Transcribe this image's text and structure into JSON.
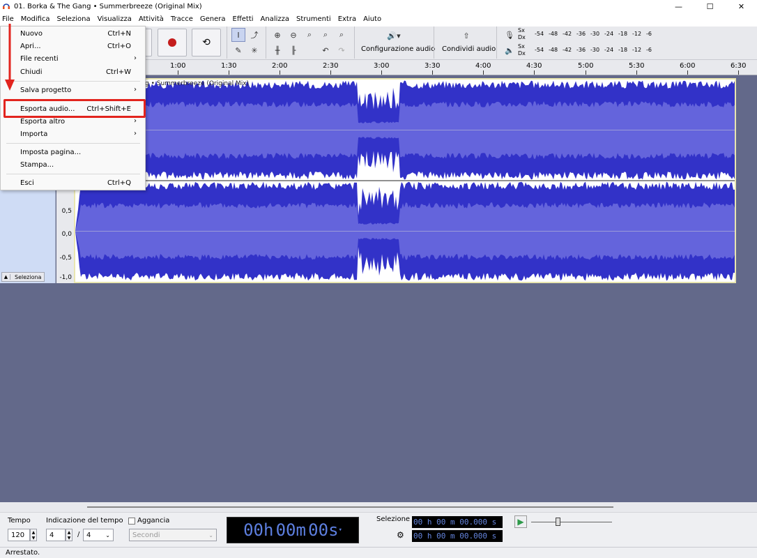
{
  "window": {
    "title": "01. Borka & The Gang • Summerbreeze (Original Mix)",
    "minimize": "—",
    "maximize": "☐",
    "close": "✕"
  },
  "menubar": [
    "File",
    "Modifica",
    "Seleziona",
    "Visualizza",
    "Attività",
    "Tracce",
    "Genera",
    "Effetti",
    "Analizza",
    "Strumenti",
    "Extra",
    "Aiuto"
  ],
  "file_menu": {
    "items": [
      {
        "label": "Nuovo",
        "shortcut": "Ctrl+N"
      },
      {
        "label": "Apri...",
        "shortcut": "Ctrl+O"
      },
      {
        "label": "File recenti",
        "submenu": true
      },
      {
        "label": "Chiudi",
        "shortcut": "Ctrl+W"
      },
      {
        "label": "Salva progetto",
        "submenu": true
      },
      {
        "label": "Esporta audio...",
        "shortcut": "Ctrl+Shift+E",
        "highlighted": true
      },
      {
        "label": "Esporta altro",
        "submenu": true
      },
      {
        "label": "Importa",
        "submenu": true
      },
      {
        "label": "Imposta pagina..."
      },
      {
        "label": "Stampa..."
      },
      {
        "label": "Esci",
        "shortcut": "Ctrl+Q"
      }
    ]
  },
  "toolbar": {
    "audio_setup_label": "Configurazione audio",
    "share_audio_label": "Condividi audio",
    "meter": {
      "rec_channels": [
        "Sx",
        "Dx"
      ],
      "play_channels": [
        "Sx",
        "Dx"
      ],
      "scale": [
        "-54",
        "-48",
        "-42",
        "-36",
        "-30",
        "-24",
        "-18",
        "-12",
        "-6"
      ]
    }
  },
  "ruler": {
    "labels": [
      "1:00",
      "1:30",
      "2:00",
      "2:30",
      "3:00",
      "3:30",
      "4:00",
      "4:30",
      "5:00",
      "5:30",
      "6:00",
      "6:30"
    ]
  },
  "track": {
    "name": "g • Summerbreeze (Original Mix)",
    "select_label": "Seleziona",
    "y_scale": [
      "0,5",
      "0,0",
      "-0,5",
      "-1,0"
    ]
  },
  "bottombar": {
    "tempo_label": "Tempo",
    "tempo_value": "120",
    "time_sig_label": "Indicazione del tempo",
    "time_sig_num": "4",
    "time_sig_sep": "/",
    "time_sig_den": "4",
    "snap_label": "Aggancia",
    "snap_unit": "Secondi",
    "time_display": {
      "h": "00",
      "h_unit": "h",
      "m": "00",
      "m_unit": "m",
      "s": "00",
      "s_unit": "s"
    },
    "selection_label": "Selezione",
    "selection_start": "00 h 00 m 00.000 s",
    "selection_end": "00 h 00 m 00.000 s"
  },
  "status": {
    "text": "Arrestato."
  },
  "colors": {
    "waveform": "#3232c8",
    "waveform_rms": "#6464dc",
    "highlight": "#e2241e",
    "record": "#c41c1c"
  }
}
